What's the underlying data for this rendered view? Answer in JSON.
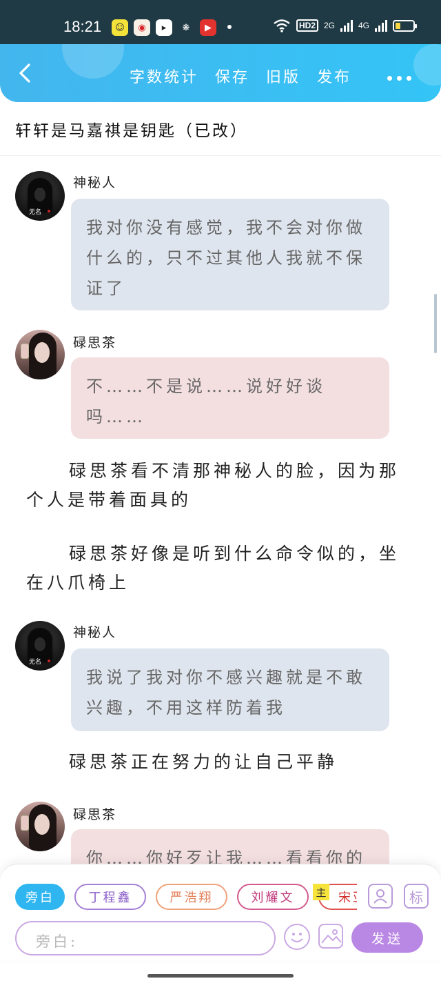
{
  "status_bar": {
    "time": "18:21",
    "network_badge": "HD2",
    "sig1": "2G",
    "sig2": "4G",
    "battery_level": 0.3
  },
  "header": {
    "actions": [
      "字数统计",
      "保存",
      "旧版",
      "发布"
    ]
  },
  "story": {
    "title": "轩轩是马嘉祺是钥匙（已改）"
  },
  "messages": [
    {
      "speaker": "神秘人",
      "text": "我对你没有感觉，我不会对你做什么的，只不过其他人我就不保证了",
      "avatar_tag": "无名"
    },
    {
      "speaker": "碌思茶",
      "text": "不……不是说……说好好谈吗……"
    },
    {
      "narration": "碌思茶看不清那神秘人的脸，因为那个人是带着面具的"
    },
    {
      "narration": "碌思茶好像是听到什么命令似的，坐在八爪椅上"
    },
    {
      "speaker": "神秘人",
      "text": "我说了我对你不感兴趣就是不敢兴趣，不用这样防着我",
      "avatar_tag": "无名"
    },
    {
      "narration": "碌思茶正在努力的让自己平静"
    },
    {
      "speaker": "碌思茶",
      "text": "你……你好歹让我……看看你的"
    }
  ],
  "input_panel": {
    "roles": [
      "旁白",
      "丁程鑫",
      "严浩翔",
      "刘耀文",
      "宋亚"
    ],
    "main_badge": "主",
    "tag_button": "标",
    "input_placeholder": "旁白:",
    "send_label": "发送"
  },
  "colors": {
    "header": "#3bbcf2",
    "bubble_mysterious": "#dfe5ee",
    "bubble_lu": "#f4dfe0",
    "send_button": "#b988e4"
  },
  "icons": [
    "back-icon",
    "more-icon",
    "person-icon",
    "emoji-icon",
    "image-icon",
    "wifi-icon",
    "signal-icon",
    "battery-icon"
  ]
}
